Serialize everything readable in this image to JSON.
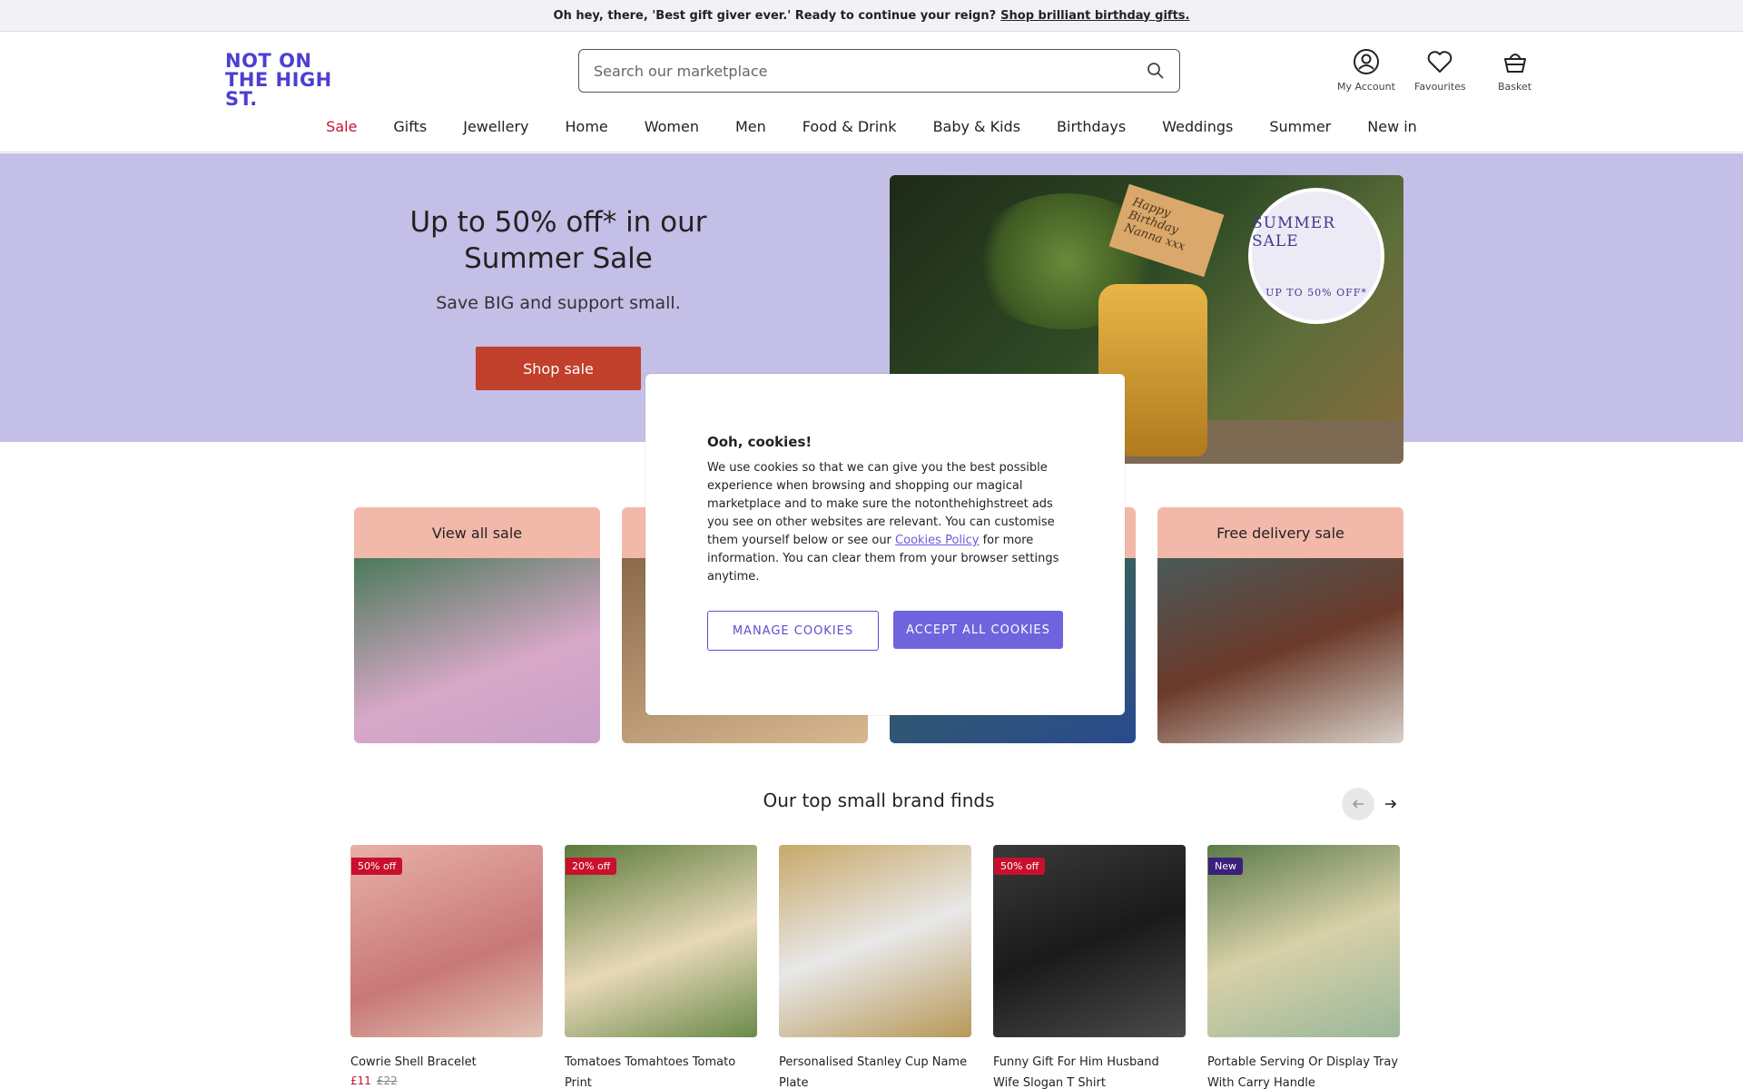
{
  "promo": {
    "text": "Oh hey, there, 'Best gift giver ever.' Ready to continue your reign?",
    "link": "Shop brilliant birthday gifts."
  },
  "header": {
    "logo_line1": "NOT ON",
    "logo_line2": "THE HIGH ST.",
    "search_placeholder": "Search our marketplace",
    "account_label": "My Account",
    "favourites_label": "Favourites",
    "basket_label": "Basket"
  },
  "nav": [
    "Sale",
    "Gifts",
    "Jewellery",
    "Home",
    "Women",
    "Men",
    "Food & Drink",
    "Baby & Kids",
    "Birthdays",
    "Weddings",
    "Summer",
    "New in"
  ],
  "hero": {
    "title": "Up to 50% off* in our Summer Sale",
    "subtitle": "Save BIG and support small.",
    "button": "Shop sale",
    "badge_top": "SUMMER SALE",
    "badge_bottom": "UP TO 50% OFF*",
    "tag_text": "Happy Birthday Nanna xxx"
  },
  "categories": [
    {
      "label": "View all sale",
      "color": "#5a8a6a"
    },
    {
      "label": "",
      "color": "#c7a06b"
    },
    {
      "label": "",
      "color": "#3a5a8e"
    },
    {
      "label": "Free delivery sale",
      "color": "#6b4a3a"
    }
  ],
  "cookie": {
    "title": "Ooh, cookies!",
    "body_before": "We use cookies so that we can give you the best possible experience when browsing and shopping our magical marketplace and to make sure the notonthehighstreet ads you see on other websites are relevant. You can customise them yourself below or see our",
    "policy_link": "Cookies Policy",
    "body_after": "for more information. You can clear them from your browser settings anytime.",
    "manage_button": "MANAGE COOKIES",
    "accept_button": "ACCEPT ALL COOKIES"
  },
  "finds": {
    "title": "Our top small brand finds",
    "products": [
      {
        "badge": "50% off",
        "name": "Cowrie Shell Bracelet",
        "price_now": "£11",
        "price_was": "£22",
        "color": "#d98a8a"
      },
      {
        "badge": "20% off",
        "name": "Tomatoes Tomahtoes Tomato Print",
        "price_now": "",
        "price_was": "",
        "color": "#6b8a4a"
      },
      {
        "badge": "",
        "name": "Personalised Stanley Cup Name Plate",
        "price_now": "",
        "price_was": "",
        "color": "#b89a5a"
      },
      {
        "badge": "50% off",
        "name": "Funny Gift For Him Husband Wife Slogan T Shirt",
        "price_now": "",
        "price_was": "",
        "color": "#2a2a2a"
      },
      {
        "badge": "New",
        "name": "Portable Serving Or Display Tray With Carry Handle",
        "price_now": "",
        "price_was": "",
        "color": "#7a9a6a"
      }
    ]
  }
}
